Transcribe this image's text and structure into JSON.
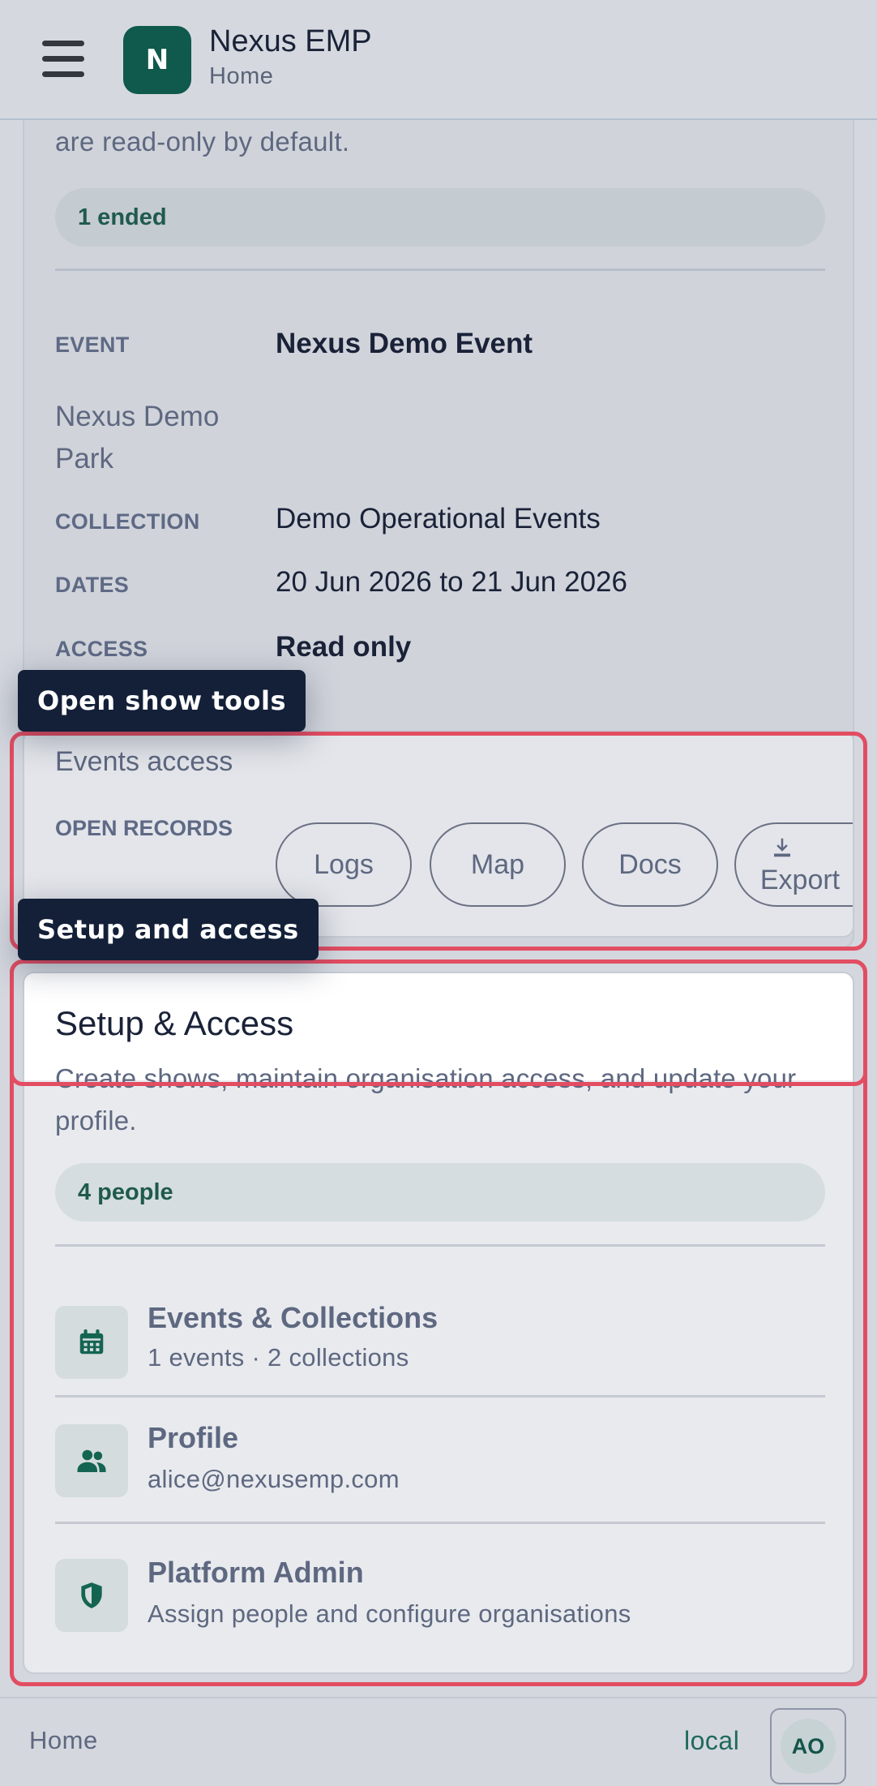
{
  "appbar": {
    "title": "Nexus EMP",
    "subtitle": "Home",
    "logo_letter": "N"
  },
  "event_card": {
    "intro_tail": "are read-only by default.",
    "badge": "1 ended",
    "event_label": "EVENT",
    "event_value": "Nexus Demo Event",
    "venue": "Nexus Demo Park",
    "collection_label": "COLLECTION",
    "collection_value": "Demo Operational Events",
    "dates_label": "DATES",
    "dates_value": "20 Jun 2026 to 21 Jun 2026",
    "access_label": "ACCESS",
    "access_value": "Read only"
  },
  "show_tools": {
    "tooltip": "Open show tools",
    "events_access": "Events access",
    "open_records_label": "OPEN RECORDS",
    "buttons": [
      "Logs",
      "Map",
      "Docs",
      "Export"
    ]
  },
  "setup": {
    "tooltip": "Setup and access",
    "title": "Setup & Access",
    "description": "Create shows, maintain organisation access, and update your profile.",
    "badge": "4 people",
    "rows": [
      {
        "title": "Events & Collections",
        "subtitle": "1 events · 2 collections",
        "icon": "calendar-icon"
      },
      {
        "title": "Profile",
        "subtitle": "alice@nexusemp.com",
        "icon": "people-icon"
      },
      {
        "title": "Platform Admin",
        "subtitle": "Assign people and configure organisations",
        "icon": "shield-icon"
      }
    ]
  },
  "bottombar": {
    "home": "Home",
    "env": "local",
    "avatar_initials": "AO"
  },
  "colors": {
    "brand": "#0f5a4c",
    "highlight": "#e24d62",
    "tooltip_bg": "#142038"
  }
}
